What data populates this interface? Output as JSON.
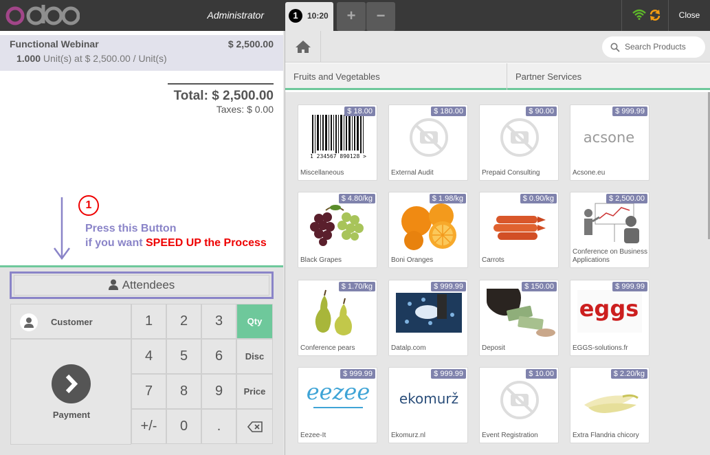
{
  "topbar": {
    "user": "Administrator",
    "order_badge": "1",
    "order_time": "10:20",
    "add_label": "+",
    "remove_label": "−",
    "close_label": "Close"
  },
  "order": {
    "line": {
      "name": "Functional Webinar",
      "price": "$ 2,500.00",
      "qty": "1.000",
      "detail": " Unit(s) at $ 2,500.00 / Unit(s)"
    },
    "total": "Total: $ 2,500.00",
    "taxes": "Taxes: $ 0.00"
  },
  "annotation": {
    "number": "1",
    "line1": "Press this Button",
    "line2_prefix": "if you want ",
    "line2_highlight": "SPEED UP the Process",
    "color": "#8a84c8",
    "highlight_color": "#ee0000"
  },
  "attendees_label": "Attendees",
  "pad": {
    "customer": "Customer",
    "payment": "Payment",
    "keys": [
      "1",
      "2",
      "3",
      "4",
      "5",
      "6",
      "7",
      "8",
      "9",
      "+/-",
      "0",
      "."
    ],
    "modes": [
      "Qty",
      "Disc",
      "Price"
    ],
    "active_mode": "Qty"
  },
  "search": {
    "placeholder": "Search Products"
  },
  "categories": [
    "Fruits and Vegetables",
    "Partner Services"
  ],
  "products": [
    {
      "name": "Miscellaneous",
      "price": "$ 18.00",
      "icon": "barcode"
    },
    {
      "name": "External Audit",
      "price": "$ 180.00",
      "icon": "no-image"
    },
    {
      "name": "Prepaid Consulting",
      "price": "$ 90.00",
      "icon": "no-image"
    },
    {
      "name": "Acsone.eu",
      "price": "$ 999.99",
      "icon": "acsone-logo",
      "logo_text": "acsone"
    },
    {
      "name": "Black Grapes",
      "price": "$ 4.80/kg",
      "icon": "grapes"
    },
    {
      "name": "Boni Oranges",
      "price": "$ 1.98/kg",
      "icon": "oranges"
    },
    {
      "name": "Carrots",
      "price": "$ 0.90/kg",
      "icon": "carrots"
    },
    {
      "name": "Conference on Business Applications",
      "price": "$ 2,500.00",
      "icon": "conference"
    },
    {
      "name": "Conference pears",
      "price": "$ 1.70/kg",
      "icon": "pears"
    },
    {
      "name": "Datalp.com",
      "price": "$ 999.99",
      "icon": "datalp"
    },
    {
      "name": "Deposit",
      "price": "$ 150.00",
      "icon": "money"
    },
    {
      "name": "EGGS-solutions.fr",
      "price": "$ 999.99",
      "icon": "eggs-logo",
      "logo_text": "eggs"
    },
    {
      "name": "Eezee-It",
      "price": "$ 999.99",
      "icon": "eezee-logo",
      "logo_text": "eezee"
    },
    {
      "name": "Ekomurz.nl",
      "price": "$ 999.99",
      "icon": "ekomurz-logo",
      "logo_text": "ekomurž"
    },
    {
      "name": "Event Registration",
      "price": "$ 10.00",
      "icon": "no-image"
    },
    {
      "name": "Extra Flandria chicory",
      "price": "$ 2.20/kg",
      "icon": "chicory"
    }
  ]
}
